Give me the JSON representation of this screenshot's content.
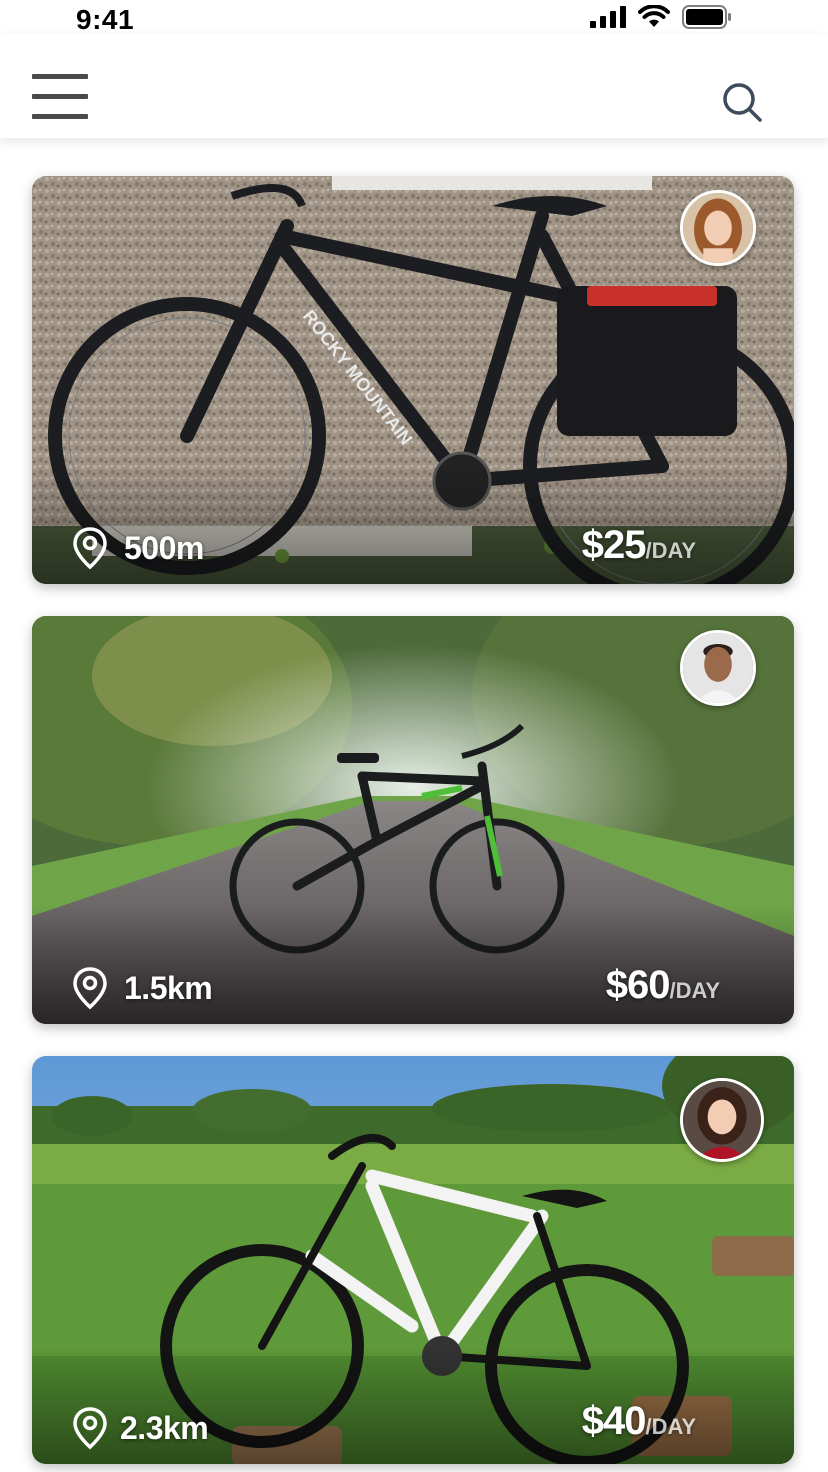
{
  "status_bar": {
    "time": "9:41",
    "signal_icon": "signal-bars-icon",
    "wifi_icon": "wifi-icon",
    "battery_icon": "battery-icon"
  },
  "nav": {
    "menu_icon": "hamburger-menu-icon",
    "search_icon": "search-icon"
  },
  "listings": [
    {
      "distance": "500m",
      "price": "$25",
      "price_unit": "/DAY",
      "photo": "black Rocky Mountain hybrid bike against pebble wall",
      "owner_avatar": "woman with auburn hair"
    },
    {
      "distance": "1.5km",
      "price": "$60",
      "price_unit": "/DAY",
      "photo": "black and green full-suspension bike on forest path",
      "owner_avatar": "smiling man"
    },
    {
      "distance": "2.3km",
      "price": "$40",
      "price_unit": "/DAY",
      "photo": "white mountain bike in grassy field with logs",
      "owner_avatar": "smiling woman in red"
    }
  ],
  "colors": {
    "icon_gray": "#4a4a4a",
    "search_gray": "#3d4b5c",
    "price_text": "#ffffff"
  }
}
